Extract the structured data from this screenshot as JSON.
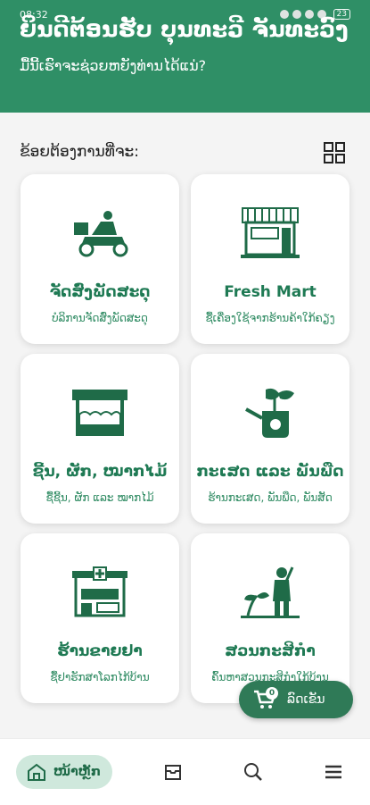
{
  "status": {
    "time": "08:32",
    "battery": "23"
  },
  "header": {
    "welcome": "ຍິນດີຕ້ອນຮັບ ບຸນທະວີ ຈັນທະວົງ",
    "subtitle": "ມື້ນີ້ເຮົາຈະຊ່ວຍຫຍັງທ່ານໄດ້ແນ່?"
  },
  "prompt": "ຂ້ອຍຕ້ອງການທີ່ຈະ:",
  "cards": [
    {
      "title": "ຈັດສົ່ງພັດສະດຸ",
      "desc": "ບໍລິການຈັດສົ່ງພັດສະດຸ",
      "icon": "delivery-scooter-icon"
    },
    {
      "title": "Fresh Mart",
      "desc": "ຊື້ເຄື່ອງໃຊ້ຈາກຮ້ານຄ້າໃກ້ຄຽງ",
      "icon": "store-icon"
    },
    {
      "title": "ຊີ້ນ, ຜັກ, ໝາກໄມ້",
      "desc": "ຊື້ຊີ້ນ, ຜັກ ແລະ ໝາກໄມ້",
      "icon": "market-stall-icon"
    },
    {
      "title": "ກະເສດ ແລະ ພັນພືດ",
      "desc": "ຮ້ານກະເສດ, ພັນພືດ, ພັນສັດ",
      "icon": "plant-watering-icon"
    },
    {
      "title": "ຮ້ານຂາຍຢາ",
      "desc": "ຊື້ຢາຮັກສາໂລກໄກ້ບ້ານ",
      "icon": "pharmacy-icon"
    },
    {
      "title": "ສວນກະສິກຳ",
      "desc": "ຄົ້ນຫາສວນກະສິກຳໃກ້ບ້ານ",
      "icon": "farmer-icon"
    }
  ],
  "cart": {
    "count": "0",
    "label": "ລົດເຂັນ"
  },
  "bottom_nav": {
    "home_label": "ໜ້າຫຼັກ"
  },
  "colors": {
    "primary": "#2f8f66",
    "card_text": "#1f7a54",
    "cart": "#2f7a57"
  }
}
